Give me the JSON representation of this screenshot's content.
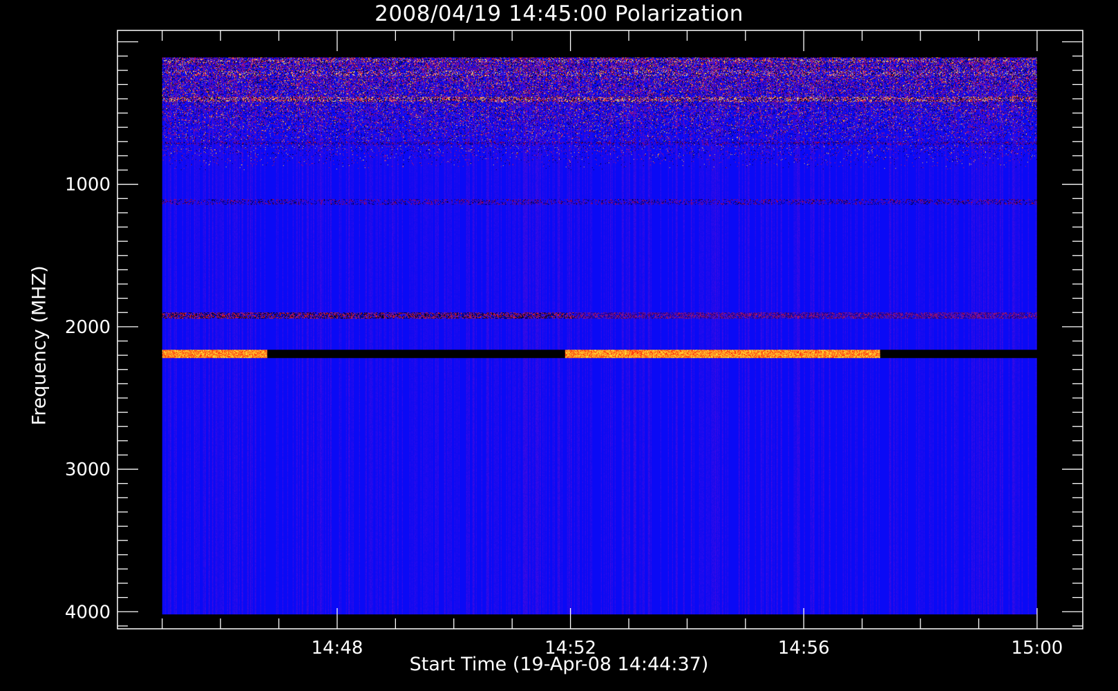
{
  "chart_data": {
    "type": "heatmap",
    "title": "2008/04/19 14:45:00 Polarization",
    "xlabel": "Start Time (19-Apr-08 14:44:37)",
    "ylabel": "Frequency (MHZ)",
    "x_range": [
      "14:45:00",
      "15:00:00"
    ],
    "x_axis_range": [
      "14:44:14",
      "15:00:47"
    ],
    "y_range_mhz": [
      110,
      4020
    ],
    "y_axis_range_mhz": [
      -80,
      4120
    ],
    "y_inverted": true,
    "x_ticks": [
      "14:48",
      "14:52",
      "14:56",
      "15:00"
    ],
    "y_ticks": [
      1000,
      2000,
      3000,
      4000
    ],
    "colorscale": [
      "#000000",
      "#0000ff",
      "#ff0000",
      "#ffff00"
    ],
    "background_color": "#0a0aff",
    "bands": [
      {
        "freq_mhz": [
          115,
          140
        ],
        "kind": "noisy",
        "intensity": 0.5
      },
      {
        "freq_mhz": [
          200,
          240
        ],
        "kind": "noisy",
        "intensity": 0.45
      },
      {
        "freq_mhz": [
          385,
          420
        ],
        "kind": "noisy",
        "intensity": 0.6
      },
      {
        "freq_mhz": [
          700,
          720
        ],
        "kind": "faint_line",
        "intensity": 0.3
      },
      {
        "freq_mhz": [
          1100,
          1140
        ],
        "kind": "faint_line",
        "intensity": 0.25
      },
      {
        "freq_mhz": [
          1900,
          1940
        ],
        "kind": "red_then_dark",
        "intensity": 0.6
      },
      {
        "freq_mhz": [
          2160,
          2220
        ],
        "kind": "strong_band",
        "intensity": 1.0
      }
    ]
  }
}
